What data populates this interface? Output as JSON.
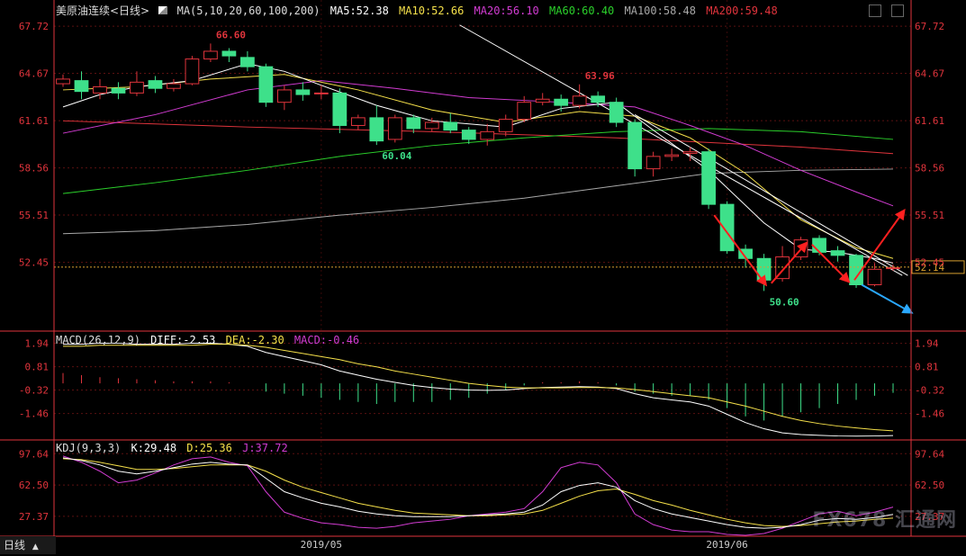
{
  "title": "美原油连续<日线>",
  "colors": {
    "up": "#e0343c",
    "down": "#3ee08a",
    "ma5": "#ffffff",
    "ma10": "#f5e04a",
    "ma20": "#d23cd2",
    "ma60": "#2bd02b",
    "ma100": "#a8a8a8",
    "ma200": "#e0343c",
    "diff": "#ffffff",
    "dea": "#f5e04a",
    "macd": "#d23cd2",
    "k": "#ffffff",
    "d": "#f5e04a",
    "j": "#d23cd2",
    "axis": "#e0343c"
  },
  "legend_main": {
    "prefix": "MA(5,10,20,60,100,200)",
    "ma5": "MA5:52.38",
    "ma10": "MA10:52.66",
    "ma20": "MA20:56.10",
    "ma60": "MA60:60.40",
    "ma100": "MA100:58.48",
    "ma200": "MA200:59.48"
  },
  "legend_macd": {
    "prefix": "MACD(26,12,9)",
    "diff": "DIFF:-2.53",
    "dea": "DEA:-2.30",
    "macd": "MACD:-0.46"
  },
  "legend_kdj": {
    "prefix": "KDJ(9,3,3)",
    "k": "K:29.48",
    "d": "D:25.36",
    "j": "J:37.72"
  },
  "tab_label": "日线",
  "watermark": "FX678 汇通网",
  "chart_data": [
    {
      "type": "candlestick",
      "name": "price",
      "ylim": [
        49.4,
        68.6
      ],
      "yticks": [
        67.72,
        64.67,
        61.61,
        58.56,
        55.51,
        52.45
      ],
      "current_price": "52.14",
      "annotations": [
        {
          "text": "66.60",
          "index": 8,
          "value": 66.6
        },
        {
          "text": "63.96",
          "index": 28,
          "value": 63.96
        },
        {
          "text": "60.04",
          "index": 17,
          "value": 60.04
        },
        {
          "text": "50.60",
          "index": 38,
          "value": 50.6
        }
      ],
      "candles": [
        [
          64.0,
          64.3,
          64.6,
          63.8
        ],
        [
          64.2,
          63.5,
          64.8,
          63.0
        ],
        [
          63.4,
          63.8,
          64.3,
          63.0
        ],
        [
          63.7,
          63.4,
          64.1,
          63.0
        ],
        [
          63.4,
          64.1,
          64.8,
          63.2
        ],
        [
          64.2,
          63.7,
          64.5,
          63.4
        ],
        [
          63.7,
          64.0,
          64.3,
          63.5
        ],
        [
          64.0,
          65.6,
          65.8,
          63.9
        ],
        [
          65.6,
          66.1,
          66.6,
          65.4
        ],
        [
          66.1,
          65.8,
          66.3,
          65.4
        ],
        [
          65.7,
          65.1,
          66.1,
          64.8
        ],
        [
          65.1,
          62.8,
          65.3,
          62.5
        ],
        [
          62.8,
          63.6,
          63.9,
          62.3
        ],
        [
          63.6,
          63.3,
          64.1,
          62.9
        ],
        [
          63.4,
          63.4,
          63.9,
          63.0
        ],
        [
          63.4,
          61.3,
          63.7,
          60.8
        ],
        [
          61.3,
          61.8,
          62.0,
          61.0
        ],
        [
          61.8,
          60.3,
          62.6,
          60.04
        ],
        [
          60.4,
          61.8,
          62.0,
          60.2
        ],
        [
          61.8,
          61.1,
          62.0,
          60.8
        ],
        [
          61.1,
          61.5,
          61.8,
          60.9
        ],
        [
          61.5,
          61.0,
          62.1,
          60.8
        ],
        [
          61.0,
          60.4,
          61.2,
          60.1
        ],
        [
          60.4,
          60.9,
          61.4,
          60.0
        ],
        [
          60.9,
          61.7,
          62.0,
          60.6
        ],
        [
          61.7,
          62.8,
          63.2,
          61.5
        ],
        [
          62.8,
          63.0,
          63.4,
          62.6
        ],
        [
          63.0,
          62.6,
          63.3,
          62.2
        ],
        [
          62.6,
          63.2,
          63.96,
          62.4
        ],
        [
          63.2,
          62.8,
          63.5,
          62.5
        ],
        [
          62.8,
          61.5,
          63.1,
          61.2
        ],
        [
          61.5,
          58.5,
          61.7,
          58.0
        ],
        [
          58.5,
          59.3,
          59.6,
          58.0
        ],
        [
          59.3,
          59.4,
          59.8,
          59.0
        ],
        [
          59.5,
          59.6,
          59.9,
          59.0
        ],
        [
          59.6,
          56.2,
          59.8,
          55.9
        ],
        [
          56.2,
          53.2,
          56.4,
          53.0
        ],
        [
          53.3,
          52.7,
          53.6,
          52.1
        ],
        [
          52.7,
          51.3,
          53.0,
          50.6
        ],
        [
          51.4,
          52.8,
          53.5,
          51.2
        ],
        [
          52.8,
          53.9,
          54.1,
          52.6
        ],
        [
          54.0,
          53.1,
          54.2,
          52.9
        ],
        [
          53.2,
          52.9,
          53.5,
          52.5
        ],
        [
          52.9,
          51.0,
          53.0,
          50.8
        ],
        [
          51.0,
          52.0,
          52.4,
          50.9
        ],
        [
          52.1,
          52.1,
          52.3,
          51.9
        ]
      ],
      "ma_lines": {
        "ma5": [
          [
            0,
            62.5
          ],
          [
            2,
            63.3
          ],
          [
            4,
            63.8
          ],
          [
            7,
            64.2
          ],
          [
            10,
            65.3
          ],
          [
            12,
            64.8
          ],
          [
            14,
            63.9
          ],
          [
            17,
            62.6
          ],
          [
            20,
            61.6
          ],
          [
            24,
            61.2
          ],
          [
            27,
            62.4
          ],
          [
            30,
            62.8
          ],
          [
            32,
            61.0
          ],
          [
            35,
            58.4
          ],
          [
            38,
            55.0
          ],
          [
            40,
            53.3
          ],
          [
            42,
            53.1
          ],
          [
            44,
            52.7
          ],
          [
            45,
            52.4
          ]
        ],
        "ma10": [
          [
            0,
            63.6
          ],
          [
            4,
            63.8
          ],
          [
            8,
            64.3
          ],
          [
            12,
            64.6
          ],
          [
            16,
            63.6
          ],
          [
            20,
            62.3
          ],
          [
            24,
            61.5
          ],
          [
            28,
            62.2
          ],
          [
            31,
            61.9
          ],
          [
            34,
            60.5
          ],
          [
            37,
            58.2
          ],
          [
            40,
            55.2
          ],
          [
            43,
            53.4
          ],
          [
            45,
            52.7
          ]
        ],
        "ma20": [
          [
            0,
            60.8
          ],
          [
            5,
            62.0
          ],
          [
            10,
            63.6
          ],
          [
            14,
            64.2
          ],
          [
            18,
            63.7
          ],
          [
            22,
            63.1
          ],
          [
            27,
            62.8
          ],
          [
            31,
            62.5
          ],
          [
            34,
            61.3
          ],
          [
            37,
            60.0
          ],
          [
            40,
            58.4
          ],
          [
            43,
            57.0
          ],
          [
            45,
            56.1
          ]
        ],
        "ma60": [
          [
            0,
            56.9
          ],
          [
            5,
            57.6
          ],
          [
            10,
            58.4
          ],
          [
            15,
            59.3
          ],
          [
            20,
            60.0
          ],
          [
            25,
            60.5
          ],
          [
            30,
            60.9
          ],
          [
            35,
            61.1
          ],
          [
            40,
            60.9
          ],
          [
            45,
            60.4
          ]
        ],
        "ma100": [
          [
            0,
            54.3
          ],
          [
            5,
            54.5
          ],
          [
            10,
            54.9
          ],
          [
            15,
            55.5
          ],
          [
            20,
            56.0
          ],
          [
            25,
            56.6
          ],
          [
            30,
            57.4
          ],
          [
            35,
            58.2
          ],
          [
            40,
            58.4
          ],
          [
            45,
            58.48
          ]
        ],
        "ma200": [
          [
            0,
            61.6
          ],
          [
            10,
            61.2
          ],
          [
            20,
            60.9
          ],
          [
            30,
            60.5
          ],
          [
            40,
            59.9
          ],
          [
            45,
            59.48
          ]
        ],
        "trend": [
          [
            21.5,
            67.8
          ],
          [
            45.5,
            51.6
          ]
        ],
        "trend2": [
          [
            31,
            62.0
          ],
          [
            45.8,
            51.6
          ]
        ]
      },
      "arrows": [
        {
          "color": "red",
          "from": [
            35.3,
            55.5
          ],
          "to": [
            38.1,
            51.0
          ]
        },
        {
          "color": "red",
          "from": [
            38.4,
            51.1
          ],
          "to": [
            40.3,
            53.7
          ]
        },
        {
          "color": "red",
          "from": [
            40.6,
            53.6
          ],
          "to": [
            42.6,
            51.2
          ]
        },
        {
          "color": "red",
          "from": [
            42.9,
            51.3
          ],
          "to": [
            45.6,
            55.8
          ]
        },
        {
          "color": "blue",
          "from": [
            43.3,
            51.0
          ],
          "to": [
            46.0,
            49.2
          ]
        }
      ],
      "xticks": [
        {
          "label": "2019/05",
          "index": 14
        },
        {
          "label": "2019/06",
          "index": 36
        }
      ]
    },
    {
      "type": "line",
      "name": "macd",
      "ylim": [
        -2.7,
        2.1
      ],
      "yticks": [
        1.94,
        0.81,
        -0.32,
        -1.46
      ],
      "series": [
        {
          "name": "DIFF",
          "values": [
            1.9,
            1.9,
            1.95,
            1.95,
            1.9,
            1.9,
            1.9,
            1.95,
            1.95,
            1.9,
            1.8,
            1.5,
            1.3,
            1.1,
            0.9,
            0.6,
            0.4,
            0.2,
            0.05,
            -0.1,
            -0.2,
            -0.28,
            -0.32,
            -0.34,
            -0.32,
            -0.25,
            -0.2,
            -0.18,
            -0.16,
            -0.18,
            -0.25,
            -0.5,
            -0.7,
            -0.8,
            -0.9,
            -1.1,
            -1.5,
            -1.9,
            -2.2,
            -2.4,
            -2.48,
            -2.52,
            -2.55,
            -2.56,
            -2.55,
            -2.53
          ]
        },
        {
          "name": "DEA",
          "values": [
            1.8,
            1.8,
            1.85,
            1.85,
            1.85,
            1.85,
            1.85,
            1.85,
            1.9,
            1.9,
            1.85,
            1.75,
            1.6,
            1.45,
            1.3,
            1.15,
            0.95,
            0.8,
            0.6,
            0.45,
            0.3,
            0.15,
            0.0,
            -0.1,
            -0.18,
            -0.22,
            -0.22,
            -0.22,
            -0.2,
            -0.2,
            -0.22,
            -0.3,
            -0.4,
            -0.5,
            -0.6,
            -0.7,
            -0.9,
            -1.1,
            -1.35,
            -1.6,
            -1.8,
            -1.95,
            -2.07,
            -2.16,
            -2.24,
            -2.3
          ]
        },
        {
          "name": "MACD",
          "values": [
            0.5,
            0.4,
            0.3,
            0.25,
            0.2,
            0.15,
            0.1,
            0.1,
            0.1,
            0.05,
            0.0,
            -0.4,
            -0.5,
            -0.6,
            -0.7,
            -0.8,
            -0.9,
            -1.0,
            -0.9,
            -0.9,
            -0.9,
            -0.8,
            -0.7,
            -0.5,
            -0.3,
            -0.1,
            0.05,
            0.05,
            0.1,
            0.05,
            -0.1,
            -0.4,
            -0.5,
            -0.6,
            -0.6,
            -0.8,
            -1.2,
            -1.6,
            -1.8,
            -1.6,
            -1.4,
            -1.2,
            -1.0,
            -0.8,
            -0.6,
            -0.46
          ]
        }
      ]
    },
    {
      "type": "line",
      "name": "kdj",
      "ylim": [
        5,
        104
      ],
      "yticks": [
        97.64,
        62.5,
        27.37
      ],
      "series": [
        {
          "name": "K",
          "values": [
            93,
            90,
            85,
            78,
            75,
            78,
            82,
            86,
            88,
            86,
            85,
            70,
            55,
            48,
            42,
            38,
            33,
            30,
            28,
            27,
            27,
            27,
            28,
            29,
            30,
            32,
            40,
            55,
            62,
            65,
            60,
            45,
            36,
            30,
            26,
            22,
            18,
            15,
            14,
            15,
            18,
            23,
            25,
            24,
            26,
            29.48
          ]
        },
        {
          "name": "D",
          "values": [
            92,
            91,
            88,
            84,
            80,
            80,
            81,
            83,
            85,
            85,
            85,
            78,
            68,
            60,
            54,
            48,
            42,
            38,
            34,
            31,
            30,
            29,
            28,
            28,
            29,
            30,
            34,
            42,
            50,
            56,
            58,
            52,
            45,
            40,
            34,
            29,
            24,
            20,
            17,
            16,
            17,
            19,
            21,
            22,
            24,
            25.36
          ]
        },
        {
          "name": "J",
          "values": [
            95,
            88,
            78,
            65,
            68,
            76,
            85,
            92,
            94,
            88,
            84,
            55,
            32,
            25,
            20,
            18,
            15,
            14,
            16,
            20,
            22,
            24,
            28,
            30,
            32,
            36,
            55,
            82,
            88,
            85,
            65,
            30,
            18,
            12,
            10,
            10,
            7,
            6,
            8,
            14,
            22,
            30,
            33,
            28,
            32,
            37.72
          ]
        }
      ]
    }
  ]
}
